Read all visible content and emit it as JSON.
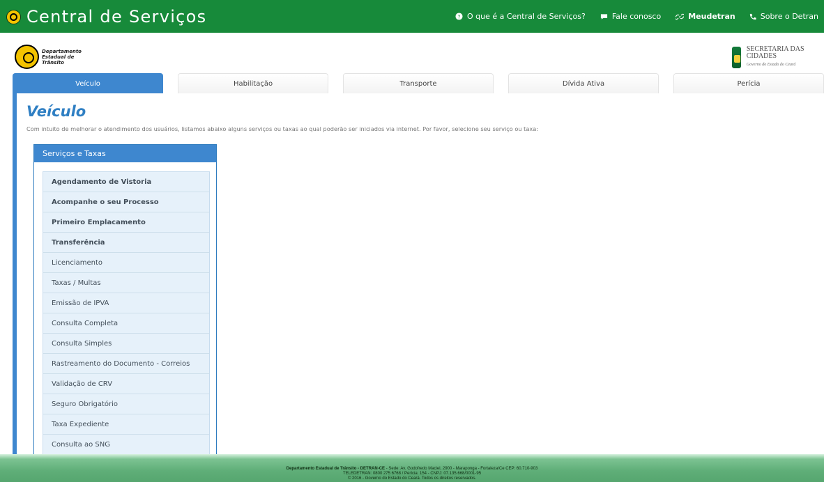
{
  "header": {
    "brand_title": "Central de Serviços",
    "links": [
      {
        "label": "O que é a Central de Serviços?",
        "icon": "question-circle-icon"
      },
      {
        "label": "Fale conosco",
        "icon": "chat-icon"
      },
      {
        "label": "Meudetran",
        "icon": "link-icon"
      },
      {
        "label": "Sobre o Detran",
        "icon": "phone-icon"
      }
    ]
  },
  "logos": {
    "detran_line1": "Departamento",
    "detran_line2": "Estadual de",
    "detran_line3": "Trânsito",
    "secretaria": "SECRETARIA DAS CIDADES",
    "governo": "Governo do Estado do Ceará"
  },
  "tabs": [
    "Veículo",
    "Habilitação",
    "Transporte",
    "Dívida Ativa",
    "Perícia"
  ],
  "page": {
    "title": "Veículo",
    "intro": "Com intuito de melhorar o atendimento dos usuários, listamos abaixo alguns serviços ou taxas ao qual poderão ser iniciados via internet. Por favor, selecione seu serviço ou taxa:"
  },
  "panel": {
    "title": "Serviços e Taxas",
    "items": [
      "Agendamento de Vistoria",
      "Acompanhe o seu Processo",
      "Primeiro Emplacamento",
      "Transferência",
      "Licenciamento",
      "Taxas / Multas",
      "Emissão de IPVA",
      "Consulta Completa",
      "Consulta Simples",
      "Rastreamento do Documento - Correios",
      "Validação de CRV",
      "Seguro Obrigatório",
      "Taxa Expediente",
      "Consulta ao SNG"
    ]
  },
  "footer": {
    "line1_bold": "Departamento Estadual de Trânsito - DETRAN-CE",
    "line1_rest": " - Sede: Av. Godofredo Maciel, 2900 - Maraponga - Fortaleza/Ce CEP: 60.710-903",
    "line2": "TELEDETRAN: 0800 275 6768 / Perícia: 154 - CNPJ: 07.135.668/0001-95",
    "line3": "© 2016 - Governo do Estado do Ceará. Todos os direitos reservados."
  }
}
